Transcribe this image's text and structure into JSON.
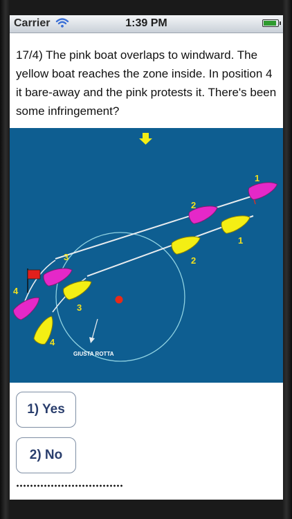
{
  "status_bar": {
    "carrier": "Carrier",
    "time": "1:39 PM"
  },
  "question": {
    "text": "17/4) The pink boat overlaps to windward. The yellow boat reaches the zone inside. In position 4 it bare-away and the pink protests it. There's been some infringement?"
  },
  "diagram": {
    "pink_labels": [
      "1",
      "2",
      "3",
      "4"
    ],
    "yellow_labels": [
      "1",
      "2",
      "3",
      "4"
    ],
    "annotation": "GIUSTA ROTTA",
    "colors": {
      "water": "#0e5e91",
      "pink_boat": "#e528c8",
      "yellow_boat": "#f4ee14",
      "mark": "#e82a18",
      "flag": "#e3201d",
      "label": "#f0e020",
      "circle": "#8fd2e2"
    }
  },
  "answers": [
    {
      "label": "1) Yes"
    },
    {
      "label": "2) No"
    }
  ],
  "footer": {
    "progress_dots": "........................"
  }
}
